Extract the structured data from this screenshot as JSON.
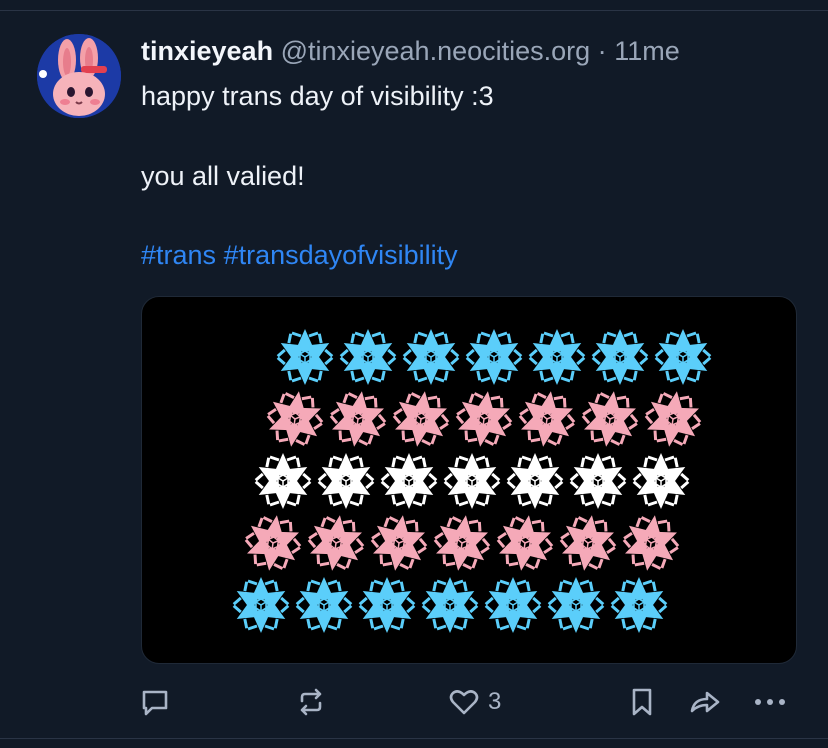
{
  "post": {
    "display_name": "tinxieyeah",
    "handle": "@tinxieyeah.neocities.org",
    "separator": "·",
    "timestamp": "11me",
    "text_line_1": "happy trans day of visibility :3",
    "text_line_2": "you all valied!",
    "hashtags": [
      "#trans",
      "#transdayofvisibility"
    ],
    "avatar_icon": "pink-bunny-avatar",
    "media": {
      "description_icon": "trans-flag-snowflake-pattern",
      "rows": [
        {
          "color": "#5bcefa",
          "count": 7
        },
        {
          "color": "#f5a9b8",
          "count": 7
        },
        {
          "color": "#ffffff",
          "count": 7
        },
        {
          "color": "#f5a9b8",
          "count": 7
        },
        {
          "color": "#5bcefa",
          "count": 7
        }
      ]
    }
  },
  "actions": {
    "reply_icon": "speech-bubble-icon",
    "boost_icon": "repost-icon",
    "like_icon": "heart-icon",
    "like_count": "3",
    "bookmark_icon": "bookmark-icon",
    "share_icon": "share-arrow-icon",
    "more_icon": "ellipsis-icon"
  },
  "colors": {
    "background": "#111a27",
    "hashtag": "#2f86f4",
    "muted": "#9aa6b8"
  }
}
